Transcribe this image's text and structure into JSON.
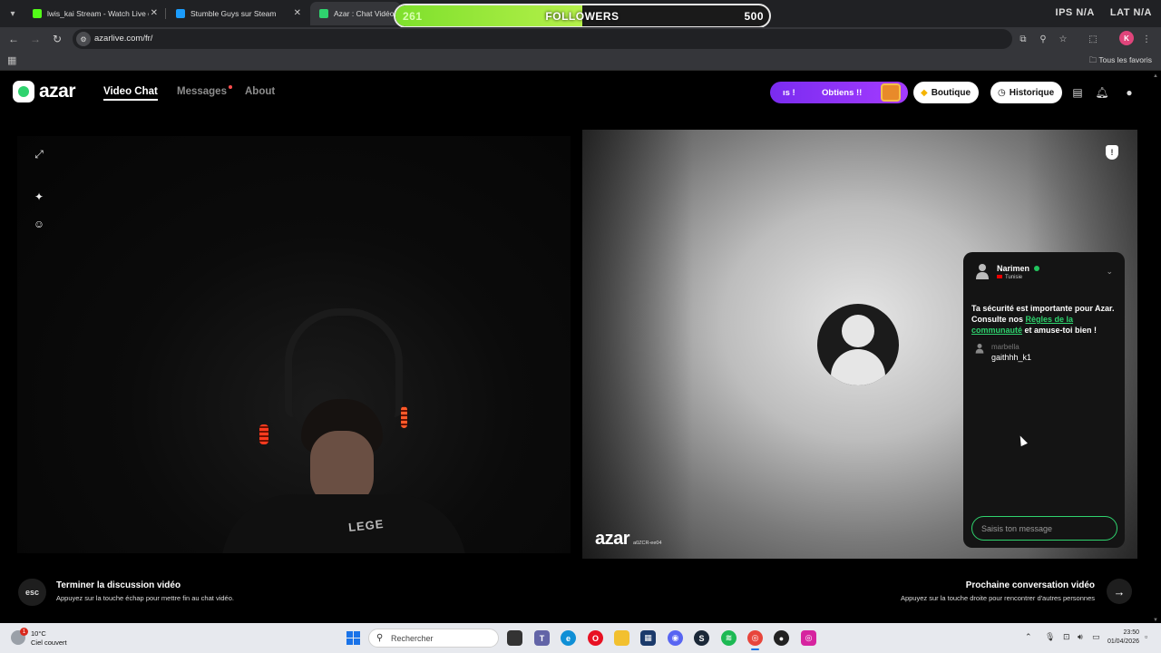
{
  "browser": {
    "tabs": [
      {
        "title": "lwis_kai Stream - Watch Live on",
        "color": "#53fc18"
      },
      {
        "title": "Stumble Guys sur Steam",
        "color": "#1b9cfc"
      },
      {
        "title": "Azar : Chat Vidéo a",
        "color": "#2fd36e"
      }
    ],
    "url": "azarlive.com/fr/",
    "profile_initial": "K",
    "bookmarks_label": "Tous les favoris"
  },
  "stream_overlay": {
    "followers_start": "261",
    "followers_label": "FOLLOWERS",
    "followers_goal": "500",
    "progress_fraction": 0.5,
    "labels": [
      "IPS N/A",
      "LAT N/A"
    ]
  },
  "site": {
    "logo": "azar",
    "nav": [
      "Video Chat",
      "Messages",
      "About"
    ],
    "promo": {
      "left": "ıs !",
      "right": "Obtiens !!"
    },
    "boutique": "Boutique",
    "historique": "Historique"
  },
  "watermark": {
    "logo": "azar",
    "id": "a0ZCR-ee04"
  },
  "chat": {
    "partner_name": "Narimen",
    "partner_country": "Tunisie",
    "safety_pre": "Ta sécurité est importante pour Azar. Consulte nos ",
    "safety_link": "Règles de la communauté",
    "safety_post": " et amuse-toi bien !",
    "messages": [
      {
        "user": "marbella",
        "text": "gaithhh_k1"
      }
    ],
    "input_placeholder": "Saisis ton message"
  },
  "footer": {
    "esc_label": "esc",
    "end_title": "Terminer la discussion vidéo",
    "end_subtitle": "Appuyez sur la touche échap pour mettre fin au chat vidéo.",
    "next_title": "Prochaine conversation vidéo",
    "next_subtitle": "Appuyez sur la touche droite pour rencontrer d'autres personnes"
  },
  "taskbar": {
    "temperature": "10°C",
    "weather": "Ciel couvert",
    "weather_badge": "1",
    "search_placeholder": "Rechercher",
    "time": "23:50",
    "date": "01/04/2026"
  },
  "accent_color": "#2fd36e"
}
